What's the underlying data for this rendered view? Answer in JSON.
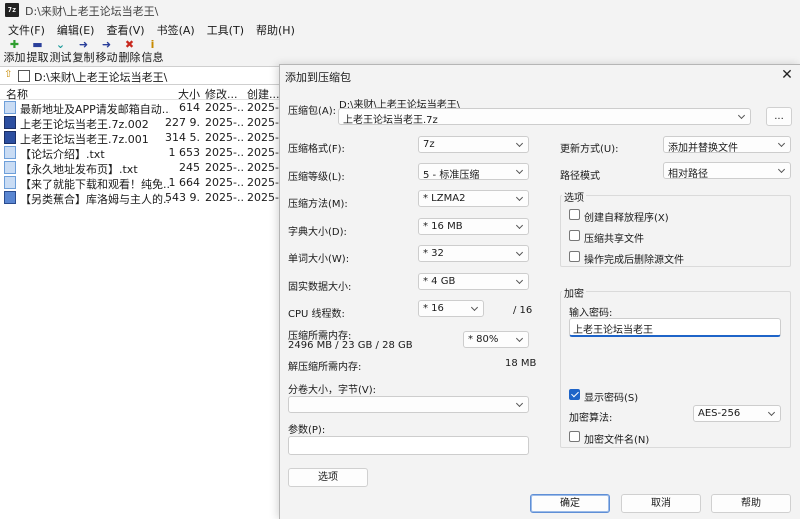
{
  "window": {
    "icon_text": "7z",
    "title": "D:\\来财\\上老王论坛当老王\\"
  },
  "menu": [
    "文件(F)",
    "编辑(E)",
    "查看(V)",
    "书签(A)",
    "工具(T)",
    "帮助(H)"
  ],
  "toolbar": [
    {
      "label": "添加",
      "icon": "plus-icon",
      "glyph": "✚",
      "color": "#2e9e2e"
    },
    {
      "label": "提取",
      "icon": "minus-icon",
      "glyph": "▬",
      "color": "#2a3f9a"
    },
    {
      "label": "测试",
      "icon": "check-arrow-icon",
      "glyph": "⌄",
      "color": "#1a9a9a"
    },
    {
      "label": "复制",
      "icon": "copy-arrow-icon",
      "glyph": "➜",
      "color": "#2a3f9a"
    },
    {
      "label": "移动",
      "icon": "move-arrow-icon",
      "glyph": "➜",
      "color": "#2a3f9a"
    },
    {
      "label": "删除",
      "icon": "delete-x-icon",
      "glyph": "✖",
      "color": "#c8281e"
    },
    {
      "label": "信息",
      "icon": "info-icon",
      "glyph": "ⅰ",
      "color": "#c78a00"
    }
  ],
  "path": "D:\\来财\\上老王论坛当老王\\",
  "list": {
    "headers": {
      "name": "名称",
      "size": "大小",
      "modified": "修改...",
      "created": "创建..."
    },
    "rows": [
      {
        "icon": "doc",
        "name": "最新地址及APP请发邮箱自动...",
        "size": "614",
        "modified": "2025-...",
        "created": "2025-..."
      },
      {
        "icon": "arc",
        "name": "上老王论坛当老王.7z.002",
        "size": "227 9...",
        "modified": "2025-...",
        "created": "2025-..."
      },
      {
        "icon": "arc",
        "name": "上老王论坛当老王.7z.001",
        "size": "314 5...",
        "modified": "2025-...",
        "created": "2025-..."
      },
      {
        "icon": "doc",
        "name": "【论坛介绍】.txt",
        "size": "1 653",
        "modified": "2025-...",
        "created": "2025-..."
      },
      {
        "icon": "doc",
        "name": "【永久地址发布页】.txt",
        "size": "245",
        "modified": "2025-...",
        "created": "2025-..."
      },
      {
        "icon": "doc",
        "name": "【来了就能下载和观看！纯免...",
        "size": "1 664",
        "modified": "2025-...",
        "created": "2025-..."
      },
      {
        "icon": "exe",
        "name": "【另类蕉合】库洛姆与主人的...",
        "size": "543 9...",
        "modified": "2025-...",
        "created": "2025-..."
      }
    ]
  },
  "dialog": {
    "title": "添加到压缩包",
    "close": "✕",
    "archive_label": "压缩包(A):",
    "archive_dir": "D:\\来财\\上老王论坛当老王\\",
    "archive_name": "上老王论坛当老王.7z",
    "browse": "...",
    "format_label": "压缩格式(F):",
    "format_value": "7z",
    "level_label": "压缩等级(L):",
    "level_value": "5 - 标准压缩",
    "method_label": "压缩方法(M):",
    "method_value": "*  LZMA2",
    "dict_label": "字典大小(D):",
    "dict_value": "*  16 MB",
    "word_label": "单词大小(W):",
    "word_value": "*  32",
    "solid_label": "固实数据大小:",
    "solid_value": "*  4 GB",
    "threads_label": "CPU 线程数:",
    "threads_value": "*  16",
    "threads_total": "/ 16",
    "mem_label": "压缩所需内存:",
    "mem_value": "2496 MB / 23 GB / 28 GB",
    "mem_pct": "*  80%",
    "decomp_label": "解压缩所需内存:",
    "decomp_value": "18 MB",
    "split_label": "分卷大小，字节(V):",
    "split_value": "",
    "params_label": "参数(P):",
    "params_value": "",
    "options_btn": "选项",
    "update_label": "更新方式(U):",
    "update_value": "添加并替换文件",
    "pathmode_label": "路径模式",
    "pathmode_value": "相对路径",
    "options_group": "选项",
    "opt_sfx": "创建自释放程序(X)",
    "opt_shared": "压缩共享文件",
    "opt_delete": "操作完成后删除源文件",
    "encrypt_group": "加密",
    "password_label": "输入密码:",
    "password_value": "上老王论坛当老王",
    "show_password": "显示密码(S)",
    "enc_method_label": "加密算法:",
    "enc_method_value": "AES-256",
    "encrypt_names": "加密文件名(N)",
    "ok": "确定",
    "cancel": "取消",
    "help": "帮助"
  }
}
